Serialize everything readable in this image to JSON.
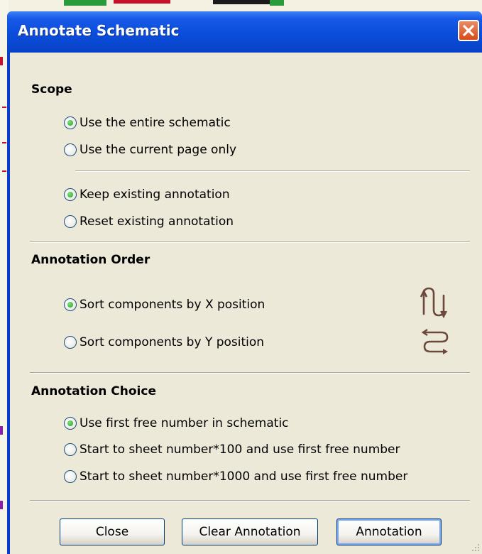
{
  "window": {
    "title": "Annotate Schematic"
  },
  "scope": {
    "label": "Scope",
    "options": [
      {
        "label": "Use the entire schematic",
        "checked": true
      },
      {
        "label": "Use the current page only",
        "checked": false
      }
    ],
    "annotation_options": [
      {
        "label": "Keep existing annotation",
        "checked": true
      },
      {
        "label": "Reset existing annotation",
        "checked": false
      }
    ]
  },
  "order": {
    "label": "Annotation Order",
    "options": [
      {
        "label": "Sort components by X position",
        "checked": true,
        "icon": "sort-x-icon"
      },
      {
        "label": "Sort components by Y position",
        "checked": false,
        "icon": "sort-y-icon"
      }
    ]
  },
  "choice": {
    "label": "Annotation Choice",
    "options": [
      {
        "label": "Use first free number in schematic",
        "checked": true
      },
      {
        "label": "Start to  sheet number*100 and use first free number",
        "checked": false
      },
      {
        "label": "Start to  sheet number*1000 and use first free number",
        "checked": false
      }
    ]
  },
  "buttons": {
    "close": "Close",
    "clear": "Clear Annotation",
    "annotate": "Annotation"
  },
  "colors": {
    "titlebar": "#0a4ddb",
    "client": "#ece9d8",
    "close_button": "#d84a1a",
    "radio_checked": "#21a121"
  }
}
